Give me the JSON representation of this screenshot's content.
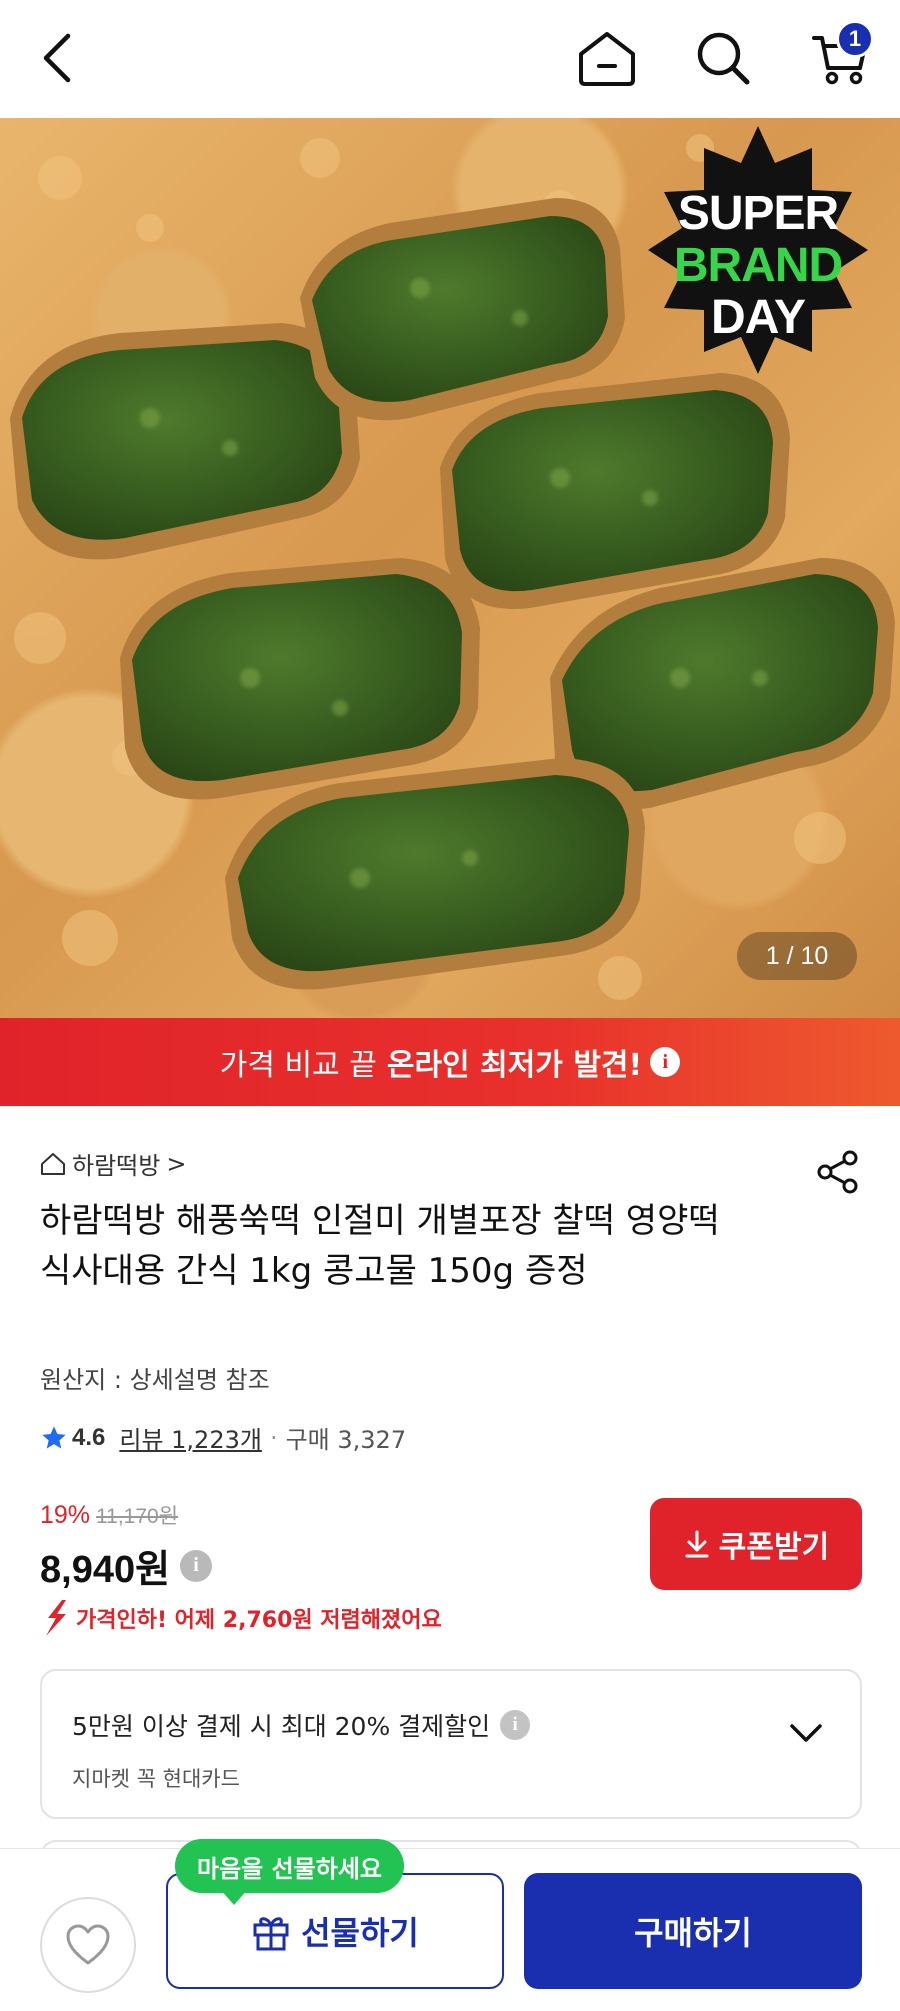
{
  "header": {
    "back_icon": "chevron-left-icon",
    "home_icon": "home-icon",
    "search_icon": "search-icon",
    "cart_icon": "cart-icon",
    "cart_count": "1"
  },
  "hero": {
    "badge": {
      "line1": "SUPER",
      "line2": "BRAND",
      "line3": "DAY"
    },
    "image_counter": "1 / 10"
  },
  "promo": {
    "text_normal": "가격 비교 끝",
    "text_strong": "온라인 최저가 발견!",
    "info_icon": "i"
  },
  "product": {
    "store_name": "하람떡방",
    "store_chevron": ">",
    "title": "하람떡방 해풍쑥떡 인절미 개별포장 찰떡 영양떡 식사대용 간식 1kg 콩고물 150g 증정",
    "origin": "원산지 : 상세설명 참조",
    "rating": "4.6",
    "reviews": "리뷰 1,223개",
    "separator": "·",
    "purchases": "구매 3,327",
    "discount": "19%",
    "original_price": "11,170원",
    "price": "8,940원",
    "price_info": "i",
    "coupon_button": "쿠폰받기",
    "price_drop_note": "가격인하! 어제 2,760원 저렴해졌어요"
  },
  "card_offer": {
    "line1": "5만원 이상 결제 시 최대  20% 결제할인",
    "info": "i",
    "line2": "지마켓 꼭 현대카드"
  },
  "bottom": {
    "gift_bubble": "마음을 선물하세요",
    "gift_button": "선물하기",
    "buy_button": "구매하기"
  },
  "colors": {
    "brand_blue": "#1a2fb0",
    "accent_red": "#e0232a",
    "gift_green": "#22c253"
  }
}
